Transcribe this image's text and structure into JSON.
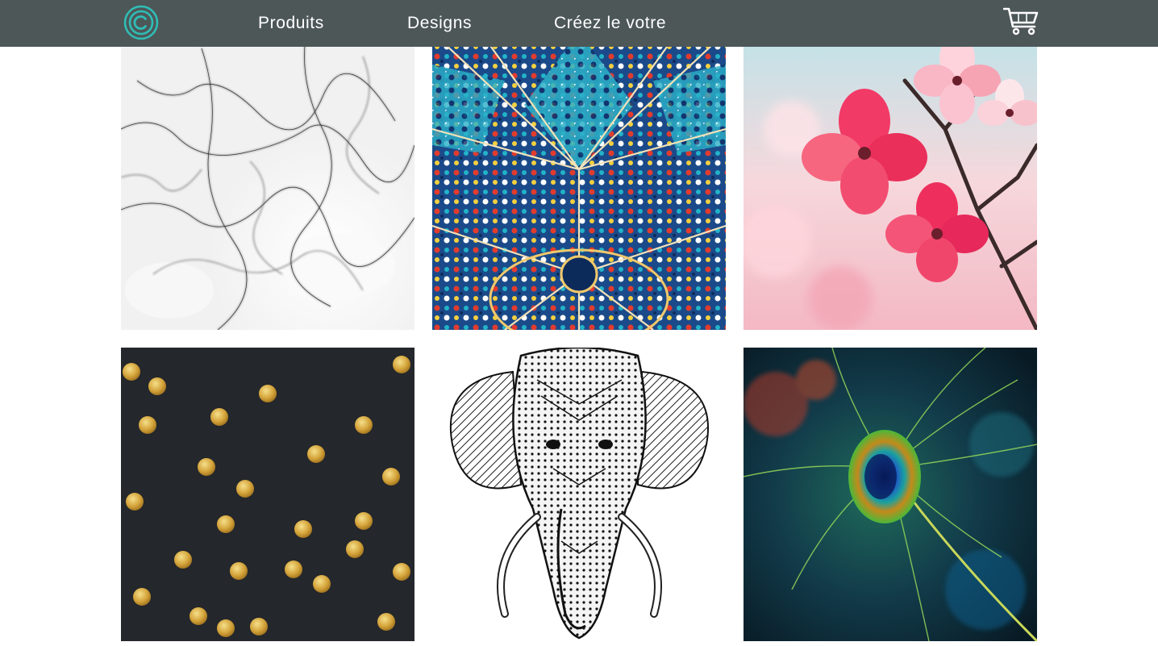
{
  "nav": {
    "logo": "logo-icon",
    "links": [
      "Produits",
      "Designs",
      "Créez le votre"
    ],
    "cart": "cart-icon"
  },
  "designs": [
    {
      "name": "marble",
      "subject": "white marble texture"
    },
    {
      "name": "mosaic",
      "subject": "persian mosaic tiles"
    },
    {
      "name": "blossom",
      "subject": "pink dogwood flowers"
    },
    {
      "name": "gold-dots",
      "subject": "gold glitter polka dots on charcoal"
    },
    {
      "name": "elephant",
      "subject": "ink patterned elephant drawing"
    },
    {
      "name": "peacock",
      "subject": "peacock feather"
    }
  ],
  "colors": {
    "nav_bg": "#4d5758",
    "logo": "#2fbdb5",
    "nav_text": "#ffffff"
  }
}
